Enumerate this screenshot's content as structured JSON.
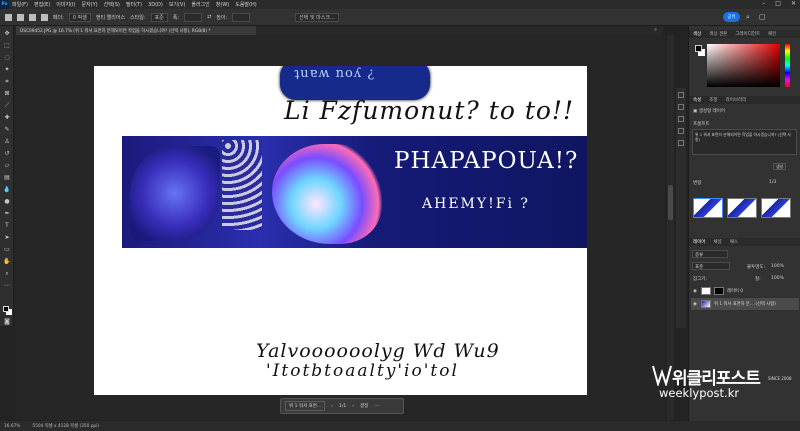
{
  "app": {
    "logo": "Ps"
  },
  "menu": [
    "파일(F)",
    "편집(E)",
    "이미지(I)",
    "문자(Y)",
    "선택(S)",
    "필터(T)",
    "3D(D)",
    "보기(V)",
    "플러그인",
    "창(W)",
    "도움말(H)"
  ],
  "window_controls": [
    "–",
    "□",
    "✕"
  ],
  "options": {
    "feather_label": "페더:",
    "feather_value": "0 픽셀",
    "anti_alias": "앤티 앨리어스",
    "style_label": "스타일:",
    "style_value": "표준",
    "width_label": "폭:",
    "height_label": "높이:",
    "select_mask": "선택 및 마스크...",
    "share": "공유"
  },
  "document_tab": "DSC09452.JPG @ 16.7% (위 1 워셔 표면하 분해되어면 작업을 하시겠습니까? (선택 사항), RGB/8) *",
  "canvas": {
    "bubble_text": "ʇuɐʍ noʎ ¿",
    "line1": "Li Fzfumonut? to to!!",
    "banner_title": "PHAPAPOUA!?",
    "banner_sub": "AHEMY!Fi ?",
    "line3": "Yalvoooooolyg Wd Wu9",
    "line4": "'Itotbtoaalty'io'tol"
  },
  "ctxbar": {
    "selection": "위 1 워셔 표면...",
    "page": "1/1",
    "mask_button": "결정"
  },
  "status": {
    "zoom": "16.67%",
    "docsize": "5504 픽셀 x 4128 픽셀 (350 ppi)"
  },
  "panels": {
    "color_tabs": [
      "색상",
      "색상 견본",
      "그레이디언트",
      "패턴"
    ],
    "props_tabs": [
      "속성",
      "조정",
      "라이브러리"
    ],
    "props_title": "생성형 레이어",
    "prompt_label": "프롬프트",
    "prompt_text": "위 1 워셔 표면하 분해되어면 작업을 하시겠습니까? (선택 사항)",
    "generate_button": "생성",
    "variations_label": "변형",
    "variations_count": "1/3",
    "layers_tabs": [
      "레이어",
      "채널",
      "패스"
    ],
    "layer_kind": "종류",
    "blend_mode": "표준",
    "opacity_label": "불투명도:",
    "opacity_value": "100%",
    "lock_label": "잠그기:",
    "fill_label": "칠:",
    "fill_value": "100%",
    "layers": [
      {
        "name": "레이어 0",
        "selected": false
      },
      {
        "name": "위 1 워셔 표면하 분... (선택 사항)",
        "selected": true
      }
    ]
  },
  "watermark": {
    "title": "위클리포스트",
    "since": "SINCE 2008",
    "url": "weeklypost.kr"
  }
}
